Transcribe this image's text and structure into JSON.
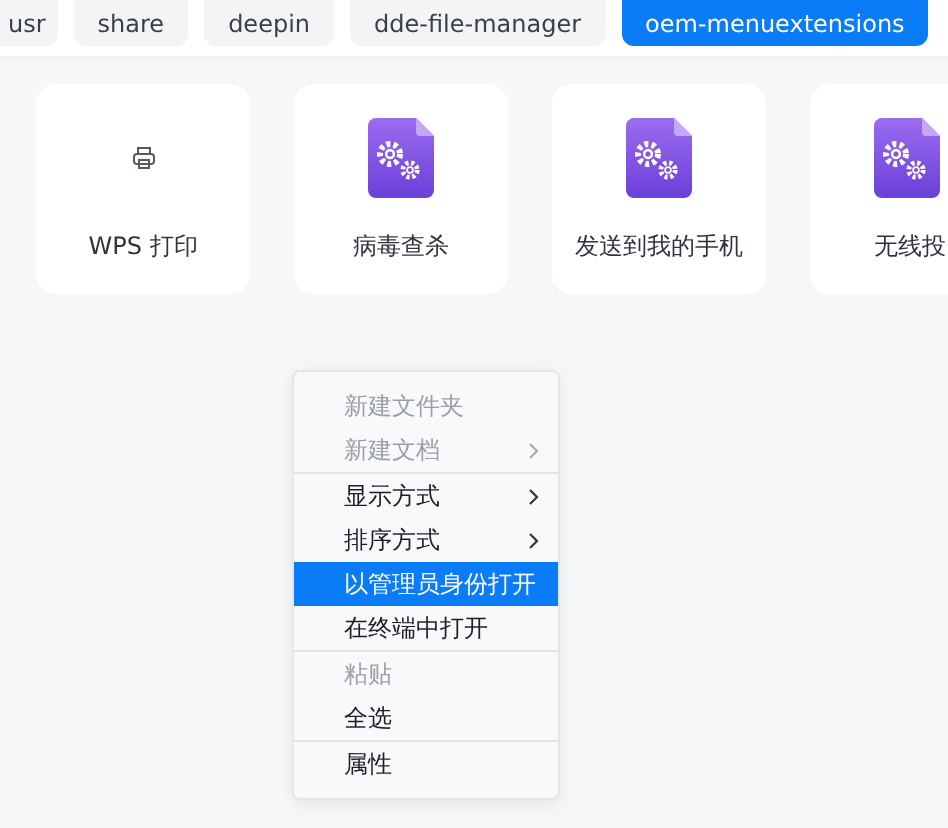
{
  "breadcrumb": [
    {
      "label": "usr",
      "selected": false
    },
    {
      "label": "share",
      "selected": false
    },
    {
      "label": "deepin",
      "selected": false
    },
    {
      "label": "dde-file-manager",
      "selected": false
    },
    {
      "label": "oem-menuextensions",
      "selected": true
    }
  ],
  "files": [
    {
      "name": "WPS 打印",
      "kind": "printer"
    },
    {
      "name": "病毒查杀",
      "kind": "config"
    },
    {
      "name": "发送到我的手机",
      "kind": "config"
    },
    {
      "name": "无线投",
      "kind": "config"
    }
  ],
  "context_menu": [
    [
      {
        "label": "新建文件夹",
        "disabled": true,
        "submenu": false,
        "selected": false
      },
      {
        "label": "新建文档",
        "disabled": true,
        "submenu": true,
        "selected": false
      }
    ],
    [
      {
        "label": "显示方式",
        "disabled": false,
        "submenu": true,
        "selected": false
      },
      {
        "label": "排序方式",
        "disabled": false,
        "submenu": true,
        "selected": false
      },
      {
        "label": "以管理员身份打开",
        "disabled": false,
        "submenu": false,
        "selected": true
      },
      {
        "label": "在终端中打开",
        "disabled": false,
        "submenu": false,
        "selected": false
      }
    ],
    [
      {
        "label": "粘贴",
        "disabled": true,
        "submenu": false,
        "selected": false
      },
      {
        "label": "全选",
        "disabled": false,
        "submenu": false,
        "selected": false
      }
    ],
    [
      {
        "label": "属性",
        "disabled": false,
        "submenu": false,
        "selected": false
      }
    ]
  ]
}
